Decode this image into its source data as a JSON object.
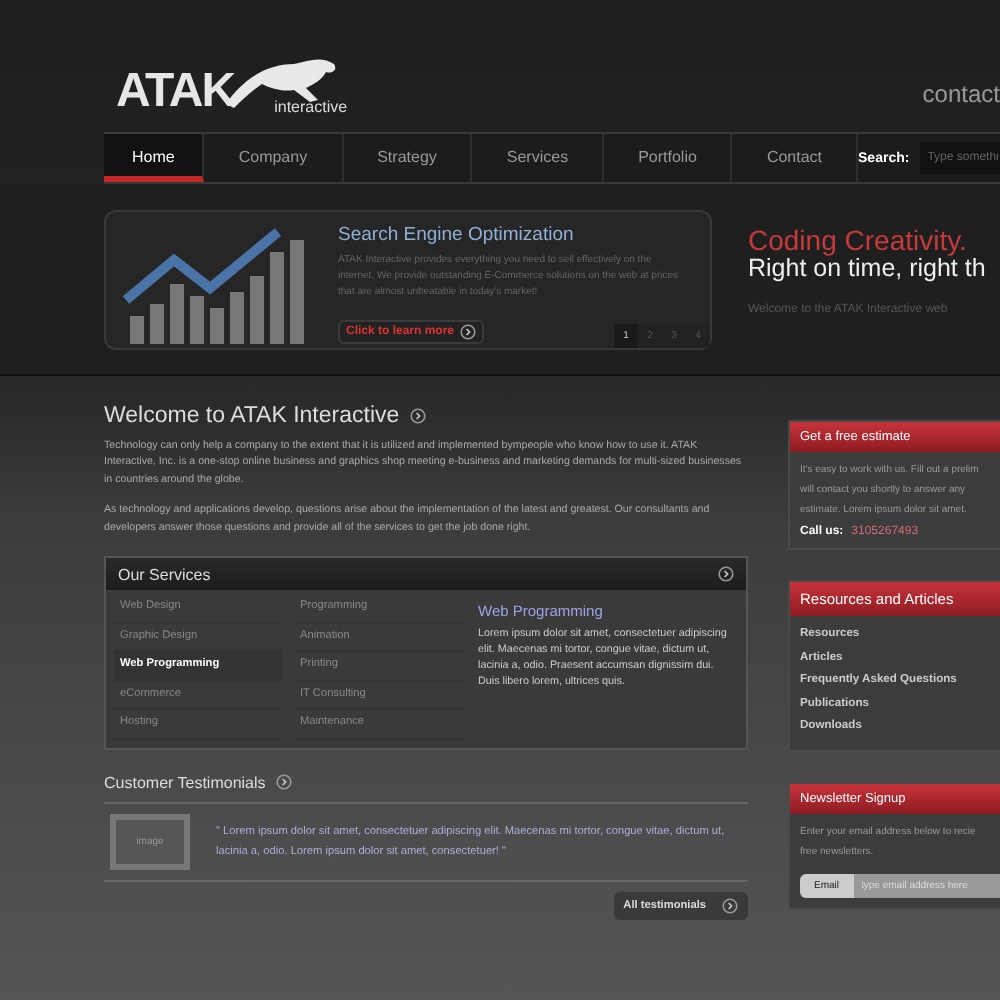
{
  "logo": {
    "name": "ATAK",
    "sub": "interactive"
  },
  "header_link": "contact",
  "nav": {
    "items": [
      {
        "label": "Home",
        "selected": true
      },
      {
        "label": "Company",
        "selected": false
      },
      {
        "label": "Strategy",
        "selected": false
      },
      {
        "label": "Services",
        "selected": false
      },
      {
        "label": "Portfolio",
        "selected": false
      },
      {
        "label": "Contact",
        "selected": false
      }
    ],
    "search": {
      "label": "Search:",
      "placeholder": "Type somethi"
    }
  },
  "slider": {
    "title": "Search Engine Optimization",
    "text": "ATAK Interactive provides everything you need to sell effectively on the internet. We provide outstanding E-Commerce solutions on the web at prices that are almost unbeatable in today's market!",
    "button": "Click to learn more",
    "pages": [
      {
        "label": "1",
        "selected": true
      },
      {
        "label": "2",
        "selected": false
      },
      {
        "label": "3",
        "selected": false
      },
      {
        "label": "4",
        "selected": false
      }
    ]
  },
  "tagline": {
    "headline": "Coding Creativity.",
    "subline": "Right on time, right th",
    "text": "Welcome to the ATAK Interactive web"
  },
  "welcome": {
    "title": "Welcome to ATAK Interactive",
    "paragraphs": [
      "Technology can only help a company to the extent that it is utilized and implemented bympeople who know how to use it. ATAK Interactive, Inc. is a one-stop online business and graphics shop meeting e-business and marketing demands for multi-sized  businesses in countries around the globe.",
      "As technology and applications develop, questions arise about the implementation of  the latest and greatest. Our consultants and developers answer those questions and provide all of the services to get the job done right."
    ]
  },
  "services": {
    "title": "Our Services",
    "column_1": [
      {
        "label": "Web Design",
        "selected": false
      },
      {
        "label": "Graphic Design",
        "selected": false
      },
      {
        "label": "Web Programming",
        "selected": true
      },
      {
        "label": "eCommerce",
        "selected": false
      },
      {
        "label": "Hosting",
        "selected": false
      }
    ],
    "column_2": [
      "Programming",
      "Animation",
      "Printing",
      "IT Consulting",
      "Maintenance"
    ],
    "detail": {
      "title": "Web Programming",
      "text": "Lorem ipsum dolor sit amet, consectetuer adipiscing elit. Maecenas mi tortor, congue vitae, dictum ut, lacinia a, odio. Praesent accumsan dignissim dui. Duis libero lorem, ultrices quis."
    }
  },
  "testimonials": {
    "title": "Customer Testimonials",
    "image_label": "image",
    "quote": "\" Lorem ipsum dolor sit amet, consectetuer adipiscing elit. Maecenas mi tortor, congue vitae, dictum ut, lacinia a, odio. Lorem ipsum dolor sit amet, consectetuer!  \"",
    "button": "All testimonials"
  },
  "estimate": {
    "title": "Get a free estimate",
    "lines": [
      "It's easy to work with us. Fill out a prelim",
      "will contact you shortly to answer any",
      "estimate. Lorem ipsum dolor sit amet."
    ],
    "call_label": "Call us:",
    "phone": "3105267493"
  },
  "resources": {
    "title": "Resources and Articles",
    "links": [
      "Resources",
      "Articles",
      "Frequently Asked Questions",
      "Publications",
      "Downloads"
    ]
  },
  "newsletter": {
    "title": "Newsletter Signup",
    "lines": [
      "Enter your email address below to recie",
      "free newsletters."
    ],
    "field_label": "Email",
    "placeholder": "type email address here"
  }
}
